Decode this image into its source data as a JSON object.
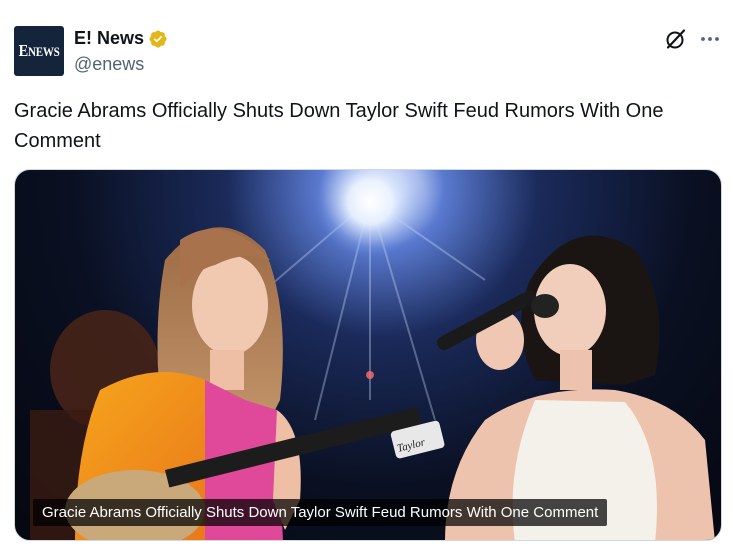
{
  "author": {
    "display_name": "E! News",
    "handle": "@enews",
    "avatar_logo": "ENEWS",
    "verified_icon": "verified-gold-badge-icon"
  },
  "actions": {
    "grok_icon": "grok-icon",
    "more_icon": "more-horizontal-icon"
  },
  "post": {
    "text": "Gracie Abrams Officially Shuts Down Taylor Swift Feud Rumors With One Comment"
  },
  "media": {
    "type": "photo",
    "caption": "Gracie Abrams Officially Shuts Down Taylor Swift Feud Rumors With One Comment",
    "guitar_brand": "Taylor"
  },
  "colors": {
    "verified_gold": "#e2b719",
    "avatar_bg": "#13243b",
    "handle_gray": "#536471"
  }
}
